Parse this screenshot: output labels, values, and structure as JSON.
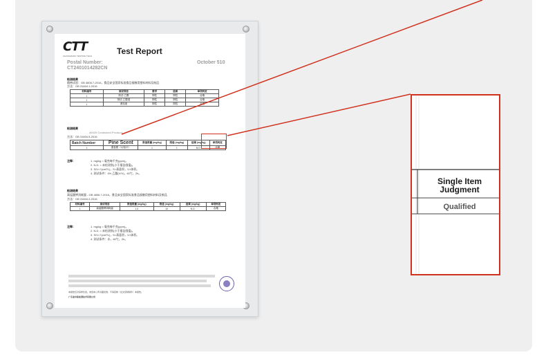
{
  "report": {
    "logo": "CTT",
    "logo_sub": "CHANGZHOU TESTING TECH",
    "title": "Test Report",
    "postal_label": "Postal Number:",
    "postal_number": "CT2401014282CN",
    "date": "October 510",
    "section1_label": "检测结果",
    "section1_standard": "随带试验：GB 4806.7-2016，食品安全国家标准食品接触用塑料材料及制品",
    "section1_method": "方法：GB 31604.1-2016",
    "table1": {
      "headers": [
        "材料编号",
        "测试项目",
        "要求",
        "结果",
        "单项判定"
      ],
      "rows": [
        [
          "1",
          "测试-乙醇",
          "阴性",
          "阴性",
          "合格"
        ],
        [
          "1",
          "测试-乙酸溶",
          "阴性",
          "阴性",
          "合格"
        ],
        [
          "1",
          "浸泡液",
          "阴性",
          "阴性",
          "合格"
        ]
      ]
    },
    "section2_label": "检测结果",
    "section2_overlay": "40020 Contained Product",
    "section2_method": "方法：GB 31604.5-2016",
    "table2": {
      "headers": [
        "Batch Number",
        "Pine Scent",
        "限值限量 (mg/kg)",
        "限值 (mg/kg)",
        "结果 (mg/kg)",
        "单项判定"
      ],
      "row": [
        "1",
        "重金属（以铅计）",
        "1",
        "1",
        "N.D.",
        "合格"
      ]
    },
    "notes_label": "注释：",
    "notes1": [
      "1. mg/kg = 毫克每千克(ppm)。",
      "2. N.D. = 未检测到(小于报告限值)。",
      "3. S/V=?(cm²/L)，S=表面积，V=体积。",
      "4. 测试条件：4% 乙酸(V/V)，60℃，2h。"
    ],
    "section3_label": "检测结果",
    "section3_standard": "高锰酸钾消耗量 - GB 4806.7-2016，食品安全国家标准食品接触用塑料材料及制品",
    "section3_method": "方法：GB 31604.2-2016",
    "table3": {
      "headers": [
        "材料编号",
        "测试项目",
        "限值限量 (mg/kg)",
        "限值 (mg/kg)",
        "结果 (mg/kg)",
        "单项判定"
      ],
      "row": [
        "1",
        "高锰酸钾消耗量",
        "1.0",
        "10",
        "N.D.",
        "合格"
      ]
    },
    "notes2": [
      "1. mg/kg = 毫克每千克(ppm)。",
      "2. N.D. = 未检测到(小于报告限值)。",
      "3. S/V=?(cm²/L)，S=表面积，V=体积。",
      "4. 测试条件：水，60℃，2h。"
    ],
    "footer_company": "广东省中毅检测技术有限公司",
    "footer_note": "本报告仅对来样负责，未经本公司书面批准，不得复制（全文复制除外）本报告。"
  },
  "zoom": {
    "header": "Single Item Judgment",
    "value": "Qualified"
  },
  "colors": {
    "accent": "#d0311d",
    "panel": "#efefef"
  }
}
